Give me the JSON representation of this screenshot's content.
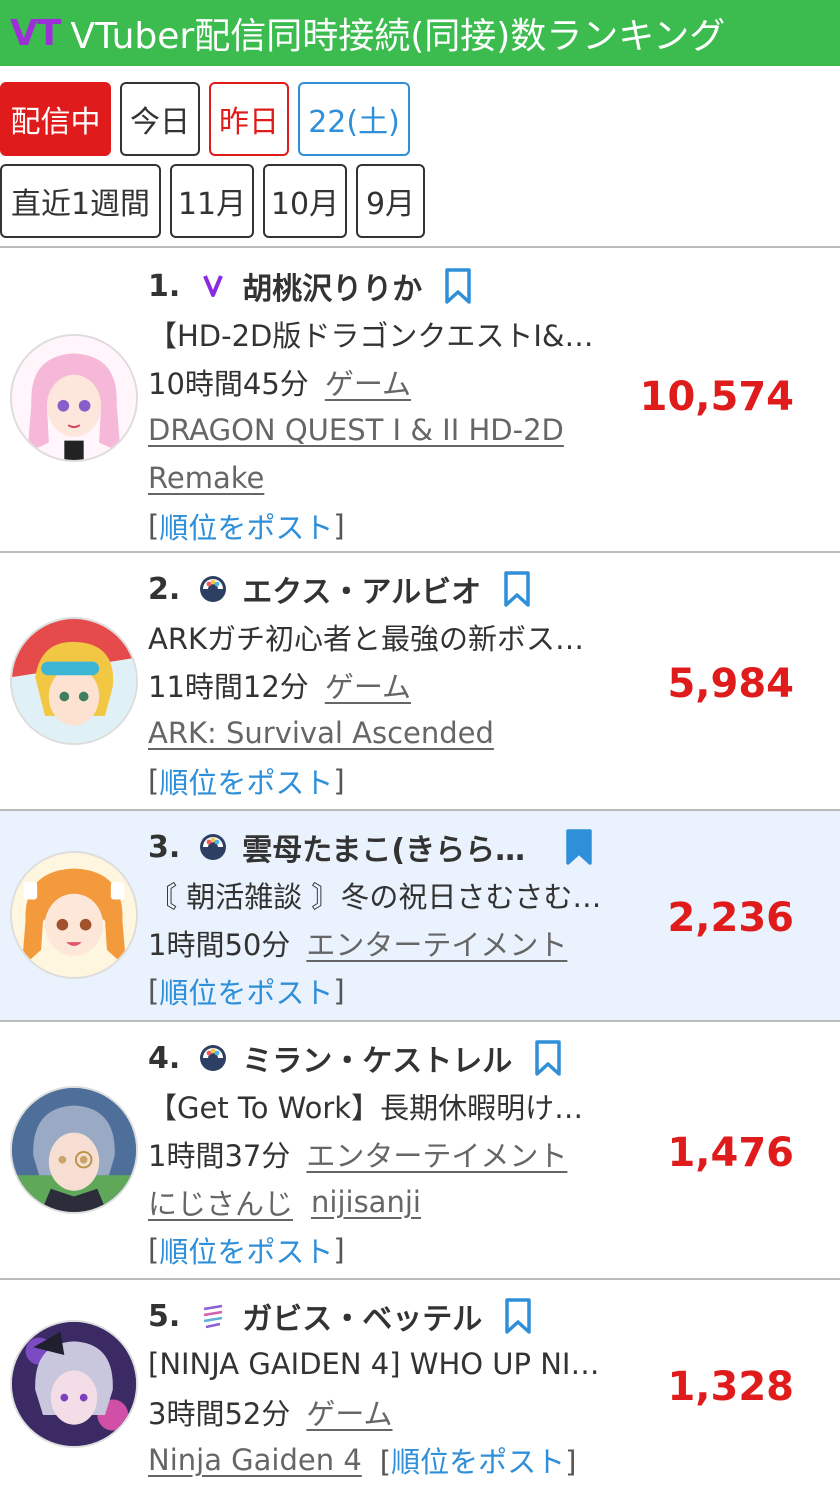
{
  "header": {
    "logo": "VT",
    "title": "VTuber配信同時接続(同接)数ランキング"
  },
  "filters": {
    "row1": [
      "配信中",
      "今日",
      "昨日",
      "22(土)"
    ],
    "row2": [
      "直近1週間",
      "11月",
      "10月",
      "9月"
    ]
  },
  "colors": {
    "header_bg": "#3cbc4f",
    "logo": "#9d2fd6",
    "accent_red": "#e01b1b",
    "link_blue": "#2f8fd8",
    "highlight_row": "#eaf3fd"
  },
  "post_label": "順位をポスト",
  "items": [
    {
      "rank": "1.",
      "agency_icon": "v-icon",
      "name": "胡桃沢りりか",
      "bookmarked": false,
      "stream_title": "【HD-2D版ドラゴンクエストI&…",
      "duration": "10時間45分",
      "category": "ゲーム",
      "game_line1": "DRAGON QUEST I & II HD-2D",
      "game_line2": "Remake",
      "viewers": "10,574"
    },
    {
      "rank": "2.",
      "agency_icon": "nijisanji-icon",
      "name": "エクス・アルビオ",
      "bookmarked": false,
      "stream_title": "ARKガチ初心者と最強の新ボス…",
      "duration": "11時間12分",
      "category": "ゲーム",
      "game_line1": "ARK: Survival Ascended",
      "viewers": "5,984"
    },
    {
      "rank": "3.",
      "agency_icon": "nijisanji-icon",
      "name": "雲母たまこ(きらら…",
      "bookmarked": true,
      "stream_title": "〘 朝活雑談 〙冬の祝日さむさむ…",
      "duration": "1時間50分",
      "category": "エンターテイメント",
      "viewers": "2,236"
    },
    {
      "rank": "4.",
      "agency_icon": "nijisanji-icon",
      "name": "ミラン・ケストレル",
      "bookmarked": false,
      "stream_title": "【Get To Work】長期休暇明け…",
      "duration": "1時間37分",
      "category": "エンターテイメント",
      "tag1": "にじさんじ",
      "tag2": "nijisanji",
      "viewers": "1,476"
    },
    {
      "rank": "5.",
      "agency_icon": "vspo-icon",
      "name": "ガビス・ベッテル",
      "bookmarked": false,
      "stream_title": "[NINJA GAIDEN 4] WHO UP NI…",
      "duration": "3時間52分",
      "category": "ゲーム",
      "game_line1": "Ninja Gaiden 4",
      "viewers": "1,328"
    }
  ]
}
